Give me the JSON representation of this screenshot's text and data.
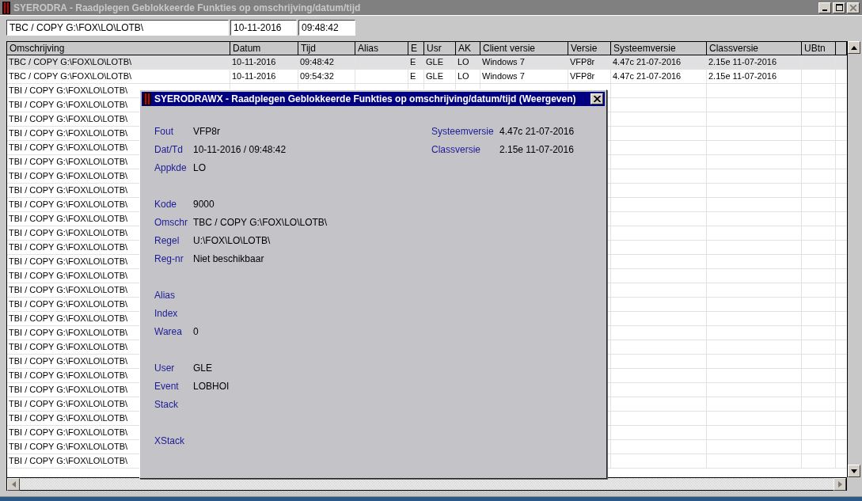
{
  "window": {
    "title": "SYERODRA - Raadplegen Geblokkeerde Funkties op omschrijving/datum/tijd"
  },
  "filter": {
    "description": "TBC / COPY G:\\FOX\\LO\\LOTB\\",
    "date": "10-11-2016",
    "time": "09:48:42"
  },
  "table": {
    "columns": [
      "Omschrijving",
      "Datum",
      "Tijd",
      "Alias",
      "E",
      "Usr",
      "AK",
      "Client versie",
      "Versie",
      "Systeemversie",
      "Classversie",
      "UBtn"
    ],
    "rows": [
      {
        "selected": true,
        "cells": [
          "TBC / COPY G:\\FOX\\LO\\LOTB\\",
          "10-11-2016",
          "09:48:42",
          null,
          "E",
          "GLE",
          "LO",
          "Windows 7",
          "VFP8r",
          "4.47c 21-07-2016",
          "2.15e 11-07-2016",
          null
        ]
      },
      {
        "selected": false,
        "cells": [
          "TBC / COPY G:\\FOX\\LO\\LOTB\\",
          "10-11-2016",
          "09:54:32",
          null,
          "E",
          "GLE",
          "LO",
          "Windows 7",
          "VFP8r",
          "4.47c 21-07-2016",
          "2.15e 11-07-2016",
          null
        ]
      },
      {
        "selected": false,
        "cells": [
          "TBI / COPY G:\\FOX\\LO\\LOTB\\"
        ]
      },
      {
        "selected": false,
        "cells": [
          "TBI / COPY G:\\FOX\\LO\\LOTB\\"
        ]
      },
      {
        "selected": false,
        "cells": [
          "TBI / COPY G:\\FOX\\LO\\LOTB\\"
        ]
      },
      {
        "selected": false,
        "cells": [
          "TBI / COPY G:\\FOX\\LO\\LOTB\\"
        ]
      },
      {
        "selected": false,
        "cells": [
          "TBI / COPY G:\\FOX\\LO\\LOTB\\"
        ]
      },
      {
        "selected": false,
        "cells": [
          "TBI / COPY G:\\FOX\\LO\\LOTB\\"
        ]
      },
      {
        "selected": false,
        "cells": [
          "TBI / COPY G:\\FOX\\LO\\LOTB\\"
        ]
      },
      {
        "selected": false,
        "cells": [
          "TBI / COPY G:\\FOX\\LO\\LOTB\\"
        ]
      },
      {
        "selected": false,
        "cells": [
          "TBI / COPY G:\\FOX\\LO\\LOTB\\"
        ]
      },
      {
        "selected": false,
        "cells": [
          "TBI / COPY G:\\FOX\\LO\\LOTB\\"
        ]
      },
      {
        "selected": false,
        "cells": [
          "TBI / COPY G:\\FOX\\LO\\LOTB\\"
        ]
      },
      {
        "selected": false,
        "cells": [
          "TBI / COPY G:\\FOX\\LO\\LOTB\\"
        ]
      },
      {
        "selected": false,
        "cells": [
          "TBI / COPY G:\\FOX\\LO\\LOTB\\"
        ]
      },
      {
        "selected": false,
        "cells": [
          "TBI / COPY G:\\FOX\\LO\\LOTB\\"
        ]
      },
      {
        "selected": false,
        "cells": [
          "TBI / COPY G:\\FOX\\LO\\LOTB\\"
        ]
      },
      {
        "selected": false,
        "cells": [
          "TBI / COPY G:\\FOX\\LO\\LOTB\\"
        ]
      },
      {
        "selected": false,
        "cells": [
          "TBI / COPY G:\\FOX\\LO\\LOTB\\"
        ]
      },
      {
        "selected": false,
        "cells": [
          "TBI / COPY G:\\FOX\\LO\\LOTB\\"
        ]
      },
      {
        "selected": false,
        "cells": [
          "TBI / COPY G:\\FOX\\LO\\LOTB\\"
        ]
      },
      {
        "selected": false,
        "cells": [
          "TBI / COPY G:\\FOX\\LO\\LOTB\\"
        ]
      },
      {
        "selected": false,
        "cells": [
          "TBI / COPY G:\\FOX\\LO\\LOTB\\"
        ]
      },
      {
        "selected": false,
        "cells": [
          "TBI / COPY G:\\FOX\\LO\\LOTB\\"
        ]
      },
      {
        "selected": false,
        "cells": [
          "TBI / COPY G:\\FOX\\LO\\LOTB\\"
        ]
      },
      {
        "selected": false,
        "cells": [
          "TBI / COPY G:\\FOX\\LO\\LOTB\\"
        ]
      },
      {
        "selected": false,
        "cells": [
          "TBI / COPY G:\\FOX\\LO\\LOTB\\"
        ]
      },
      {
        "selected": false,
        "cells": [
          "TBI / COPY G:\\FOX\\LO\\LOTB\\"
        ]
      },
      {
        "selected": false,
        "cells": [
          "TBI / COPY G:\\FOX\\LO\\LOTB\\"
        ]
      }
    ]
  },
  "dialog": {
    "title": "SYERODRAWX - Raadplegen Geblokkeerde Funkties op omschrijving/datum/tijd (Weergeven)",
    "field_groups": [
      [
        {
          "label": "Fout",
          "value": "VFP8r"
        },
        {
          "label": "Dat/Td",
          "value": "10-11-2016 / 09:48:42"
        },
        {
          "label": "Appkde",
          "value": "LO"
        }
      ],
      [
        {
          "label": "Kode",
          "value": "9000"
        },
        {
          "label": "Omschr",
          "value": "TBC / COPY G:\\FOX\\LO\\LOTB\\"
        },
        {
          "label": "Regel",
          "value": "U:\\FOX\\LO\\LOTB\\"
        },
        {
          "label": "Reg-nr",
          "value": "Niet beschikbaar"
        }
      ],
      [
        {
          "label": "Alias"
        },
        {
          "label": "Index"
        },
        {
          "label": "Warea",
          "value": "0"
        }
      ],
      [
        {
          "label": "User",
          "value": "GLE"
        },
        {
          "label": "Event",
          "value": "LOBHOI"
        },
        {
          "label": "Stack"
        }
      ],
      [
        {
          "label": "XStack"
        }
      ]
    ],
    "version_fields": [
      {
        "label": "Systeemversie",
        "value": "4.47c 21-07-2016"
      },
      {
        "label": "Classversie",
        "value": "2.15e 11-07-2016"
      }
    ]
  }
}
